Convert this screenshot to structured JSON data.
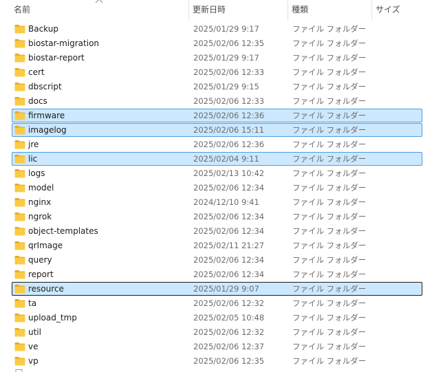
{
  "columns": {
    "name": "名前",
    "date": "更新日時",
    "type": "種類",
    "size": "サイズ"
  },
  "sort": {
    "column": "name",
    "direction": "ascending"
  },
  "colors": {
    "selection_fill": "#cce8ff",
    "selection_border": "#4b9be0",
    "focus_border": "#1b1b1b",
    "folder_yellow": "#f8c841"
  },
  "icons": {
    "folder": "folder-icon",
    "sort": "sort-arrow-up-icon"
  },
  "rows": [
    {
      "name": "Backup",
      "date": "2025/01/29 9:17",
      "type": "ファイル フォルダー",
      "size": "",
      "state": "normal"
    },
    {
      "name": "biostar-migration",
      "date": "2025/02/06 12:35",
      "type": "ファイル フォルダー",
      "size": "",
      "state": "normal"
    },
    {
      "name": "biostar-report",
      "date": "2025/01/29 9:17",
      "type": "ファイル フォルダー",
      "size": "",
      "state": "normal"
    },
    {
      "name": "cert",
      "date": "2025/02/06 12:33",
      "type": "ファイル フォルダー",
      "size": "",
      "state": "normal"
    },
    {
      "name": "dbscript",
      "date": "2025/01/29 9:15",
      "type": "ファイル フォルダー",
      "size": "",
      "state": "normal"
    },
    {
      "name": "docs",
      "date": "2025/02/06 12:33",
      "type": "ファイル フォルダー",
      "size": "",
      "state": "normal"
    },
    {
      "name": "firmware",
      "date": "2025/02/06 12:36",
      "type": "ファイル フォルダー",
      "size": "",
      "state": "selected"
    },
    {
      "name": "imagelog",
      "date": "2025/02/06 15:11",
      "type": "ファイル フォルダー",
      "size": "",
      "state": "selected"
    },
    {
      "name": "jre",
      "date": "2025/02/06 12:36",
      "type": "ファイル フォルダー",
      "size": "",
      "state": "normal"
    },
    {
      "name": "lic",
      "date": "2025/02/04 9:11",
      "type": "ファイル フォルダー",
      "size": "",
      "state": "selected"
    },
    {
      "name": "logs",
      "date": "2025/02/13 10:42",
      "type": "ファイル フォルダー",
      "size": "",
      "state": "normal"
    },
    {
      "name": "model",
      "date": "2025/02/06 12:34",
      "type": "ファイル フォルダー",
      "size": "",
      "state": "normal"
    },
    {
      "name": "nginx",
      "date": "2024/12/10 9:41",
      "type": "ファイル フォルダー",
      "size": "",
      "state": "normal"
    },
    {
      "name": "ngrok",
      "date": "2025/02/06 12:34",
      "type": "ファイル フォルダー",
      "size": "",
      "state": "normal"
    },
    {
      "name": "object-templates",
      "date": "2025/02/06 12:34",
      "type": "ファイル フォルダー",
      "size": "",
      "state": "normal"
    },
    {
      "name": "qrImage",
      "date": "2025/02/11 21:27",
      "type": "ファイル フォルダー",
      "size": "",
      "state": "normal"
    },
    {
      "name": "query",
      "date": "2025/02/06 12:34",
      "type": "ファイル フォルダー",
      "size": "",
      "state": "normal"
    },
    {
      "name": "report",
      "date": "2025/02/06 12:34",
      "type": "ファイル フォルダー",
      "size": "",
      "state": "normal"
    },
    {
      "name": "resource",
      "date": "2025/01/29 9:07",
      "type": "ファイル フォルダー",
      "size": "",
      "state": "focused"
    },
    {
      "name": "ta",
      "date": "2025/02/06 12:32",
      "type": "ファイル フォルダー",
      "size": "",
      "state": "normal"
    },
    {
      "name": "upload_tmp",
      "date": "2025/02/05 10:48",
      "type": "ファイル フォルダー",
      "size": "",
      "state": "normal"
    },
    {
      "name": "util",
      "date": "2025/02/06 12:32",
      "type": "ファイル フォルダー",
      "size": "",
      "state": "normal"
    },
    {
      "name": "ve",
      "date": "2025/02/06 12:37",
      "type": "ファイル フォルダー",
      "size": "",
      "state": "normal"
    },
    {
      "name": "vp",
      "date": "2025/02/06 12:35",
      "type": "ファイル フォルダー",
      "size": "",
      "state": "normal"
    }
  ]
}
